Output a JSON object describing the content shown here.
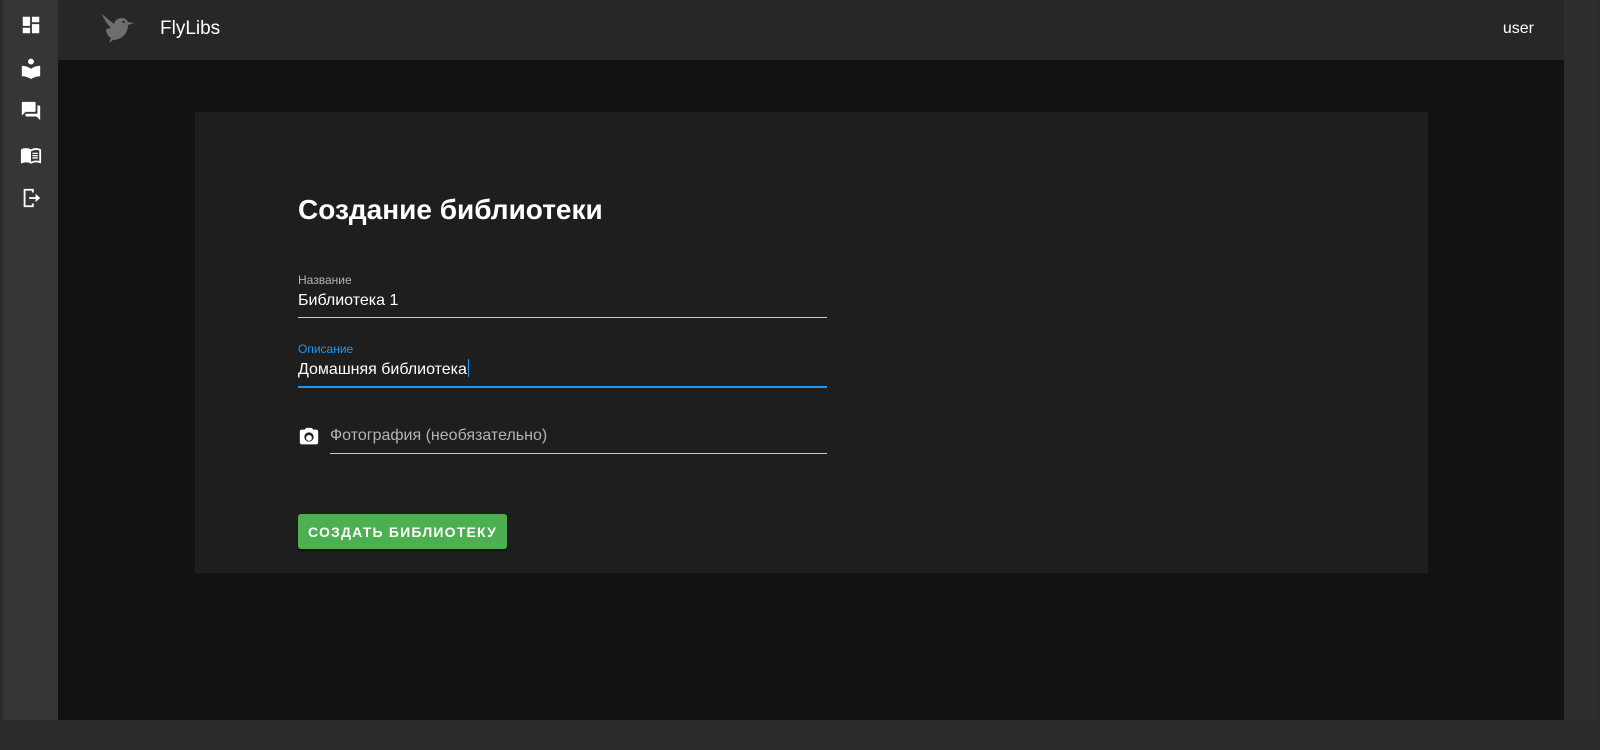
{
  "app": {
    "title": "FlyLibs",
    "user": "user"
  },
  "sidebar": {
    "icons": [
      "dashboard-icon",
      "reader-icon",
      "chat-icon",
      "book-open-icon",
      "logout-icon"
    ]
  },
  "form": {
    "title": "Создание библиотеки",
    "name": {
      "label": "Название",
      "value": "Библиотека 1"
    },
    "description": {
      "label": "Описание",
      "value": "Домашняя библиотека"
    },
    "photo": {
      "placeholder": "Фотография (необязательно)"
    },
    "submit_label": "СОЗДАТЬ БИБЛИОТЕКУ"
  },
  "colors": {
    "accent": "#2196f3",
    "submit": "#4caf50",
    "card": "#1e1e1e",
    "background": "#121212"
  }
}
